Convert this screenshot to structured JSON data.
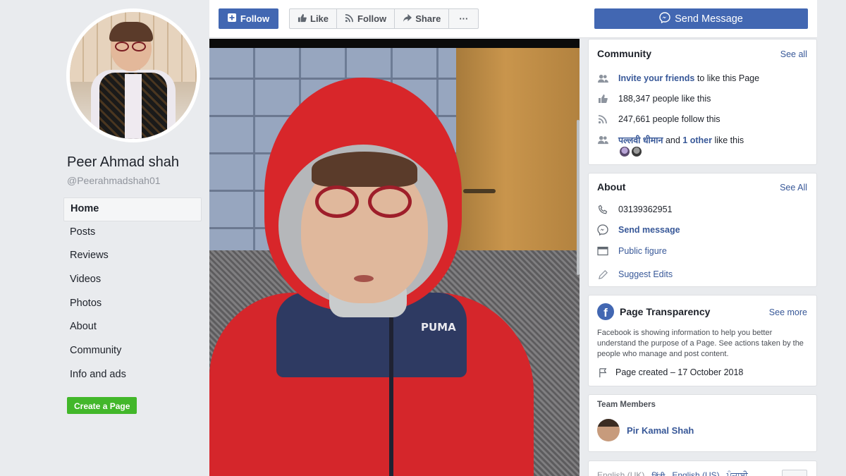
{
  "profile": {
    "name": "Peer Ahmad shah",
    "handle": "@Peerahmadshah01"
  },
  "nav": {
    "items": [
      {
        "label": "Home",
        "active": true
      },
      {
        "label": "Posts"
      },
      {
        "label": "Reviews"
      },
      {
        "label": "Videos"
      },
      {
        "label": "Photos"
      },
      {
        "label": "About"
      },
      {
        "label": "Community"
      },
      {
        "label": "Info and ads"
      }
    ],
    "create_page": "Create a Page"
  },
  "actions": {
    "follow_primary": "Follow",
    "like": "Like",
    "follow": "Follow",
    "share": "Share",
    "more": "···",
    "send_message": "Send Message"
  },
  "photo": {
    "jacket_logo": "PUMA"
  },
  "community": {
    "title": "Community",
    "see_all": "See all",
    "invite_link": "Invite your friends",
    "invite_rest": "to like this Page",
    "likes": "188,347 people like this",
    "follows": "247,661 people follow this",
    "friend_name": "पल्लवी धीमान",
    "and": "and",
    "others_link": "1 other",
    "like_this": "like this"
  },
  "about": {
    "title": "About",
    "see_all": "See All",
    "phone": "03139362951",
    "send_message": "Send message",
    "category": "Public figure",
    "suggest_edits": "Suggest Edits"
  },
  "transparency": {
    "title": "Page Transparency",
    "see_more": "See more",
    "description": "Facebook is showing information to help you better understand the purpose of a Page. See actions taken by the people who manage and post content.",
    "created": "Page created – 17 October 2018",
    "badge": "f"
  },
  "team": {
    "title": "Team Members",
    "member": "Pir Kamal Shah"
  },
  "languages": {
    "items": [
      "English (UK)",
      "हिंदी",
      "English (US)",
      "ਪੰਜਾਬੀ"
    ]
  },
  "colors": {
    "brand": "#4267b2",
    "link": "#385898",
    "create_green": "#42b72a",
    "bg": "#e9ebee"
  },
  "icons": {
    "follow_button": "rss-plus-icon",
    "like": "thumb-up-icon",
    "follow": "rss-icon",
    "share": "share-arrow-icon",
    "send": "messenger-icon",
    "phone": "phone-icon",
    "category": "card-icon",
    "edit": "pencil-icon",
    "flag": "flag-icon"
  }
}
